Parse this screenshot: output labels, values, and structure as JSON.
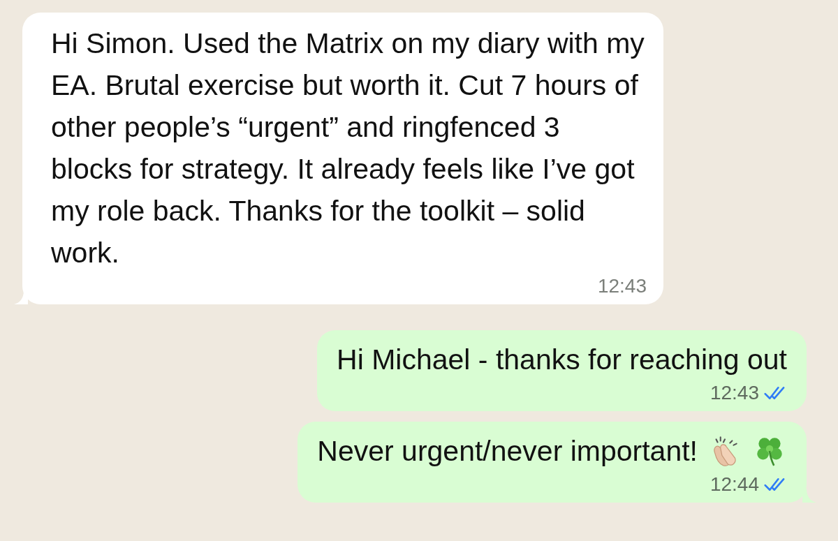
{
  "messages": [
    {
      "kind": "incoming",
      "text": "Hi Simon. Used the Matrix on my diary with my EA. Brutal exercise but worth it. Cut 7 hours of other people’s “urgent” and ringfenced 3 blocks for strategy. It already feels like I’ve got my role back. Thanks for the toolkit – solid work.",
      "time": "12:43"
    },
    {
      "kind": "outgoing",
      "text": "Hi Michael - thanks for reaching out",
      "time": "12:43",
      "read": true
    },
    {
      "kind": "outgoing_with_emoji",
      "text": "Never urgent/never important!",
      "time": "12:44",
      "read": true
    }
  ]
}
